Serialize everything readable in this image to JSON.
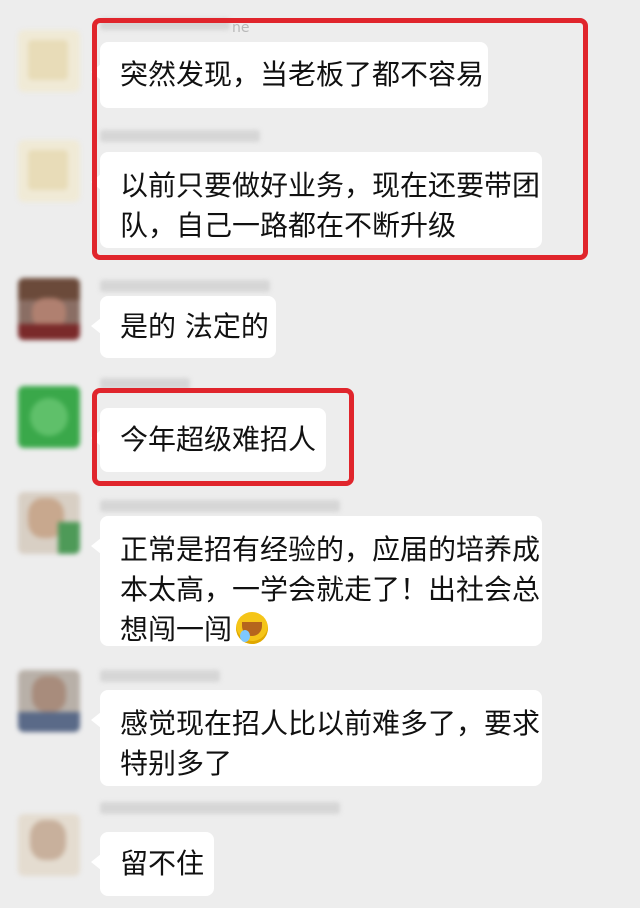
{
  "messages": [
    {
      "text": "突然发现，当老板了都不容易"
    },
    {
      "lines": [
        "以前只要做好业务，现在还要带团",
        "队，自己一路都在不断升级"
      ]
    },
    {
      "text": "是的 法定的"
    },
    {
      "text": "今年超级难招人"
    },
    {
      "lines": [
        "正常是招有经验的，应届的培养成",
        "本太高，一学会就走了！出社会总",
        "想闯一闯"
      ],
      "emoji": "facepalm-emoji"
    },
    {
      "lines": [
        "感觉现在招人比以前难多了，要求",
        "特别多了"
      ]
    },
    {
      "text": "留不住"
    }
  ],
  "top_name_fragment": "ne",
  "highlight_color": "#e0252c"
}
